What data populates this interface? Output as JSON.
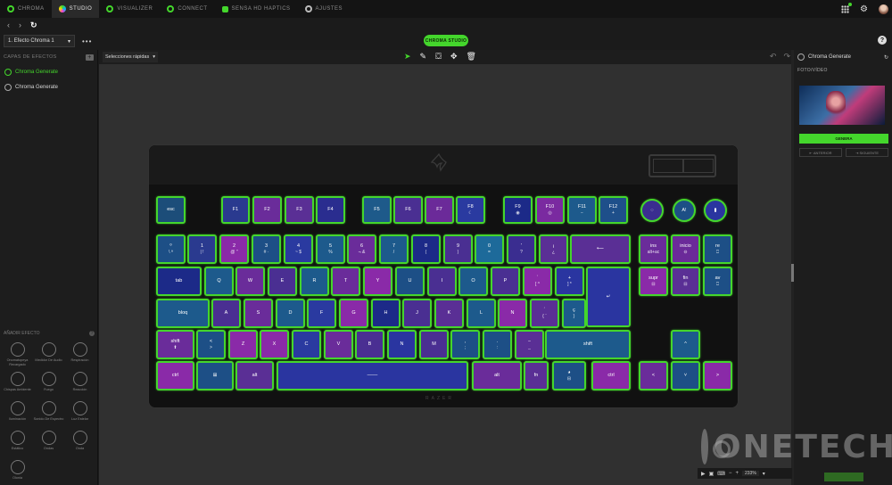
{
  "top_tabs": [
    {
      "label": "CHROMA",
      "active": false,
      "icon": "chroma-icon"
    },
    {
      "label": "STUDIO",
      "active": true,
      "icon": "studio-icon"
    },
    {
      "label": "VISUALIZER",
      "active": false,
      "icon": "visualizer-icon"
    },
    {
      "label": "CONNECT",
      "active": false,
      "icon": "connect-icon"
    },
    {
      "label": "SENSA HD HAPTICS",
      "active": false,
      "icon": "haptics-icon"
    },
    {
      "label": "AJUSTES",
      "active": false,
      "icon": "gear-icon"
    }
  ],
  "toolbar": {
    "effect_select": "1. Efecto Chroma 1",
    "studio_button": "CHROMA STUDIO"
  },
  "left_panel": {
    "layers_header": "CAPAS DE EFECTOS",
    "layers": [
      {
        "label": "Chroma Generate",
        "selected": true
      },
      {
        "label": "Chroma Generate",
        "selected": false
      }
    ],
    "add_effect_header": "AÑADIR EFECTO",
    "effects": [
      "Onomatopeya Recargado",
      "Medidor De Audio",
      "Respiración",
      "Chispas Ambiente",
      "Fuego",
      "Reacción",
      "Iluminación",
      "Sonido De Espectro",
      "Luz Estelar",
      "Estático",
      "Ondas",
      "Onda",
      "Olonia"
    ]
  },
  "canvas_toolbar": {
    "quick_select": "Selecciones rápidas"
  },
  "keyboard": {
    "brand": "RAZER",
    "rows": [
      [
        {
          "label": "esc",
          "sub": "",
          "color": "#1c4d79"
        },
        {
          "label": "F1",
          "sub": "",
          "color": "#2a3a8f"
        },
        {
          "label": "F2",
          "sub": "",
          "color": "#6a2c9a"
        },
        {
          "label": "F3",
          "sub": "",
          "color": "#5a2f95"
        },
        {
          "label": "F4",
          "sub": "",
          "color": "#2a2d8f"
        },
        {
          "label": "F5",
          "sub": "",
          "color": "#1e5a8a"
        },
        {
          "label": "F6",
          "sub": "",
          "color": "#4a2f92"
        },
        {
          "label": "F7",
          "sub": "",
          "color": "#6b2a99"
        },
        {
          "label": "F8",
          "sub": "☾",
          "color": "#2a3aa0"
        },
        {
          "label": "F9",
          "sub": "◉",
          "color": "#1c2a88"
        },
        {
          "label": "F10",
          "sub": "◎",
          "color": "#7a2aa0"
        },
        {
          "label": "F11",
          "sub": "−",
          "color": "#1d5a8c"
        },
        {
          "label": "F12",
          "sub": "+",
          "color": "#1e4f8a"
        },
        {
          "label": "◌",
          "sub": "",
          "color": "#3a2d90"
        },
        {
          "label": "A!",
          "sub": "",
          "color": "#1d4f86"
        },
        {
          "label": "▮",
          "sub": "",
          "color": "#2a35a0"
        }
      ],
      [
        {
          "label": "º",
          "sub": "\\  ª",
          "color": "#1d4f86"
        },
        {
          "label": "1",
          "sub": "|  !",
          "color": "#2a3a8f"
        },
        {
          "label": "2",
          "sub": "@  \"",
          "color": "#8a2aa8"
        },
        {
          "label": "3",
          "sub": "#  ·",
          "color": "#1d4f86"
        },
        {
          "label": "4",
          "sub": "~  $",
          "color": "#2a3aa0"
        },
        {
          "label": "5",
          "sub": "%",
          "color": "#1d5a8c"
        },
        {
          "label": "6",
          "sub": "¬  &",
          "color": "#6a2c9a"
        },
        {
          "label": "7",
          "sub": "/",
          "color": "#1d5a8c"
        },
        {
          "label": "8",
          "sub": "(",
          "color": "#1c2a88"
        },
        {
          "label": "9",
          "sub": ")",
          "color": "#4a2f92"
        },
        {
          "label": "0",
          "sub": "=",
          "color": "#1d6a9a"
        },
        {
          "label": "'",
          "sub": "?",
          "color": "#3a2d90"
        },
        {
          "label": "¡",
          "sub": "¿",
          "color": "#5a2f95"
        },
        {
          "label": "⟵",
          "sub": "",
          "color": "#5a2f95"
        },
        {
          "label": "ins",
          "sub": "alt+ac",
          "color": "#6a2c9a"
        },
        {
          "label": "inicio",
          "sub": "⊝",
          "color": "#6b2a99"
        },
        {
          "label": "re",
          "sub": "⎕",
          "color": "#1d4f86"
        }
      ],
      [
        {
          "label": "tab",
          "sub": "",
          "color": "#1c2a88"
        },
        {
          "label": "Q",
          "sub": "",
          "color": "#1d5a8c"
        },
        {
          "label": "W",
          "sub": "",
          "color": "#6a2c9a"
        },
        {
          "label": "E",
          "sub": "",
          "color": "#4a2f92"
        },
        {
          "label": "R",
          "sub": "",
          "color": "#1d5a8c"
        },
        {
          "label": "T",
          "sub": "",
          "color": "#6a2c9a"
        },
        {
          "label": "Y",
          "sub": "",
          "color": "#8a2aa8"
        },
        {
          "label": "U",
          "sub": "",
          "color": "#1d4f86"
        },
        {
          "label": "I",
          "sub": "",
          "color": "#4a2f92"
        },
        {
          "label": "O",
          "sub": "",
          "color": "#1d5a8c"
        },
        {
          "label": "P",
          "sub": "",
          "color": "#4a2f92"
        },
        {
          "label": "`",
          "sub": "[  ^",
          "color": "#8a2aa8"
        },
        {
          "label": "+",
          "sub": "]  *",
          "color": "#2a35a0"
        },
        {
          "label": "↵",
          "sub": "",
          "color": "#2a35a0"
        },
        {
          "label": "supr",
          "sub": "⊟",
          "color": "#8a2aa8"
        },
        {
          "label": "fin",
          "sub": "⊟",
          "color": "#5a2f95"
        },
        {
          "label": "av",
          "sub": "⎕",
          "color": "#1d4f86"
        }
      ],
      [
        {
          "label": "bloq",
          "sub": "",
          "color": "#1d5a8c"
        },
        {
          "label": "A",
          "sub": "",
          "color": "#4a2f92"
        },
        {
          "label": "S",
          "sub": "",
          "color": "#6a2c9a"
        },
        {
          "label": "D",
          "sub": "",
          "color": "#1d5a8c"
        },
        {
          "label": "F",
          "sub": "",
          "color": "#2a3aa0"
        },
        {
          "label": "G",
          "sub": "",
          "color": "#8a2aa8"
        },
        {
          "label": "H",
          "sub": "",
          "color": "#1c2a88"
        },
        {
          "label": "J",
          "sub": "",
          "color": "#4a2f92"
        },
        {
          "label": "K",
          "sub": "",
          "color": "#5a2f95"
        },
        {
          "label": "L",
          "sub": "",
          "color": "#1d5a8c"
        },
        {
          "label": "N",
          "sub": "",
          "color": "#8a2aa8"
        },
        {
          "label": "´",
          "sub": "{  ¨",
          "color": "#5a2f95"
        },
        {
          "label": "ç",
          "sub": "}",
          "color": "#1d5a8c"
        }
      ],
      [
        {
          "label": "shift",
          "sub": "⬆",
          "color": "#6a2c9a"
        },
        {
          "label": "<",
          "sub": ">",
          "color": "#1d4f86"
        },
        {
          "label": "Z",
          "sub": "",
          "color": "#8a2aa8"
        },
        {
          "label": "X",
          "sub": "",
          "color": "#8a2aa8"
        },
        {
          "label": "C",
          "sub": "",
          "color": "#2a3aa0"
        },
        {
          "label": "V",
          "sub": "",
          "color": "#6a2c9a"
        },
        {
          "label": "B",
          "sub": "",
          "color": "#4a2f92"
        },
        {
          "label": "N",
          "sub": "",
          "color": "#2a35a0"
        },
        {
          "label": "M",
          "sub": "",
          "color": "#4a2f92"
        },
        {
          "label": ",",
          "sub": ";",
          "color": "#1d4f86"
        },
        {
          "label": ".",
          "sub": ":",
          "color": "#1d4f86"
        },
        {
          "label": "−",
          "sub": "_",
          "color": "#5a2f95"
        },
        {
          "label": "shift",
          "sub": "",
          "color": "#1d5a8c"
        },
        {
          "label": "^",
          "sub": "",
          "color": "#1d5a8c"
        }
      ],
      [
        {
          "label": "ctrl",
          "sub": "",
          "color": "#8a2aa8"
        },
        {
          "label": "⊞",
          "sub": "",
          "color": "#1d4f86"
        },
        {
          "label": "alt",
          "sub": "",
          "color": "#5a2f95"
        },
        {
          "label": "───",
          "sub": "",
          "color": "#2a35a0"
        },
        {
          "label": "alt",
          "sub": "",
          "color": "#6a2c9a"
        },
        {
          "label": "fn",
          "sub": "",
          "color": "#5a2f95"
        },
        {
          "label": "◕",
          "sub": "⊟",
          "color": "#1d4f86"
        },
        {
          "label": "ctrl",
          "sub": "",
          "color": "#8a2aa8"
        },
        {
          "label": "<",
          "sub": "",
          "color": "#6a2c9a"
        },
        {
          "label": "˅",
          "sub": "",
          "color": "#1d4f86"
        },
        {
          "label": ">",
          "sub": "",
          "color": "#8a2aa8"
        }
      ]
    ]
  },
  "right_panel": {
    "title": "Chroma Generate",
    "section": "FOTO/VÍDEO",
    "select_button": "GENERA",
    "prev_button": "ANTERIOR",
    "next_button": "SIGUIENTE"
  },
  "playbar": {
    "zoom": "233%"
  },
  "watermark": "ONETECH",
  "colors": {
    "accent": "#44d62c",
    "panel_bg": "#1d1d1d",
    "canvas_bg": "#303030"
  }
}
